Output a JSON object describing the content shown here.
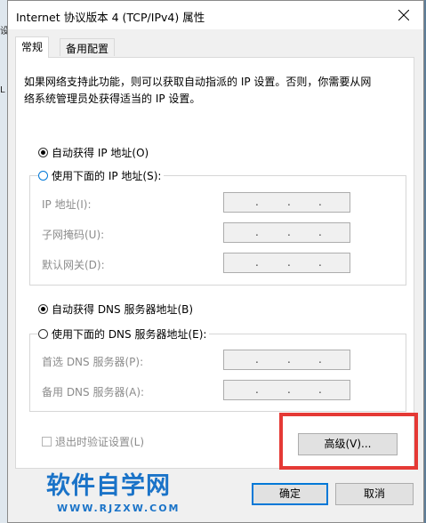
{
  "background": {
    "fragments": [
      "设",
      "L"
    ]
  },
  "window": {
    "title": "Internet 协议版本 4 (TCP/IPv4) 属性"
  },
  "tabs": [
    {
      "label": "常规"
    },
    {
      "label": "备用配置"
    }
  ],
  "description": {
    "line1": "如果网络支持此功能，则可以获取自动指派的 IP 设置。否则，你需要从网",
    "line2": "络系统管理员处获得适当的 IP 设置。"
  },
  "ip_section": {
    "auto_label": "自动获得 IP 地址(O)",
    "manual_label": "使用下面的 IP 地址(S):",
    "fields": [
      {
        "label": "IP 地址(I):",
        "value": ". . ."
      },
      {
        "label": "子网掩码(U):",
        "value": ". . ."
      },
      {
        "label": "默认网关(D):",
        "value": ". . ."
      }
    ]
  },
  "dns_section": {
    "auto_label": "自动获得 DNS 服务器地址(B)",
    "manual_label": "使用下面的 DNS 服务器地址(E):",
    "fields": [
      {
        "label": "首选 DNS 服务器(P):",
        "value": ". . ."
      },
      {
        "label": "备用 DNS 服务器(A):",
        "value": ". . ."
      }
    ]
  },
  "validate_label": "退出时验证设置(L)",
  "buttons": {
    "advanced": "高级(V)...",
    "ok": "确定",
    "cancel": "取消"
  },
  "watermark": {
    "text": "软件自学网",
    "url": "WWW.RJZXW.COM"
  },
  "colors": {
    "accent": "#0078d7",
    "highlight": "#e53935",
    "watermark": "#1a73c8"
  }
}
